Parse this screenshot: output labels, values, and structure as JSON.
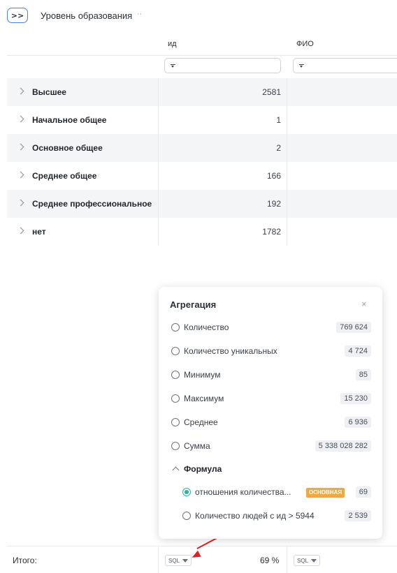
{
  "toolbar": {
    "expand_symbol": ">>",
    "group_title": "Уровень образования",
    "menu_symbol": "··"
  },
  "columns": [
    {
      "header": "ид"
    },
    {
      "header": "ФИО"
    }
  ],
  "rows": [
    {
      "label": "Высшее",
      "value": "2581"
    },
    {
      "label": "Начальное общее",
      "value": "1"
    },
    {
      "label": "Основное общее",
      "value": "2"
    },
    {
      "label": "Среднее общее",
      "value": "166"
    },
    {
      "label": "Среднее профессиональное",
      "value": "192"
    },
    {
      "label": "нет",
      "value": "1782"
    }
  ],
  "footer": {
    "label": "Итого:",
    "sql_label": "SQL",
    "percent": "69 %"
  },
  "popup": {
    "title": "Агрегация",
    "close_symbol": "×",
    "options": [
      {
        "label": "Количество",
        "count": "769 624"
      },
      {
        "label": "Количество уникальных",
        "count": "4 724"
      },
      {
        "label": "Минимум",
        "count": "85"
      },
      {
        "label": "Максимум",
        "count": "15 230"
      },
      {
        "label": "Среднее",
        "count": "6 936"
      },
      {
        "label": "Сумма",
        "count": "5 338 028 282"
      }
    ],
    "formula_section": "Формула",
    "formulas": [
      {
        "label": "отношения количества...",
        "badge": "ОСНОВНАЯ",
        "count": "69",
        "selected": true
      },
      {
        "label": "Количество людей с ид > 5944",
        "count": "2 539",
        "selected": false
      }
    ]
  },
  "colors": {
    "accent_teal": "#2fb3a8",
    "badge_orange": "#f0a845",
    "annotation_red": "#e02121",
    "button_border_blue": "#4f7fd9"
  }
}
